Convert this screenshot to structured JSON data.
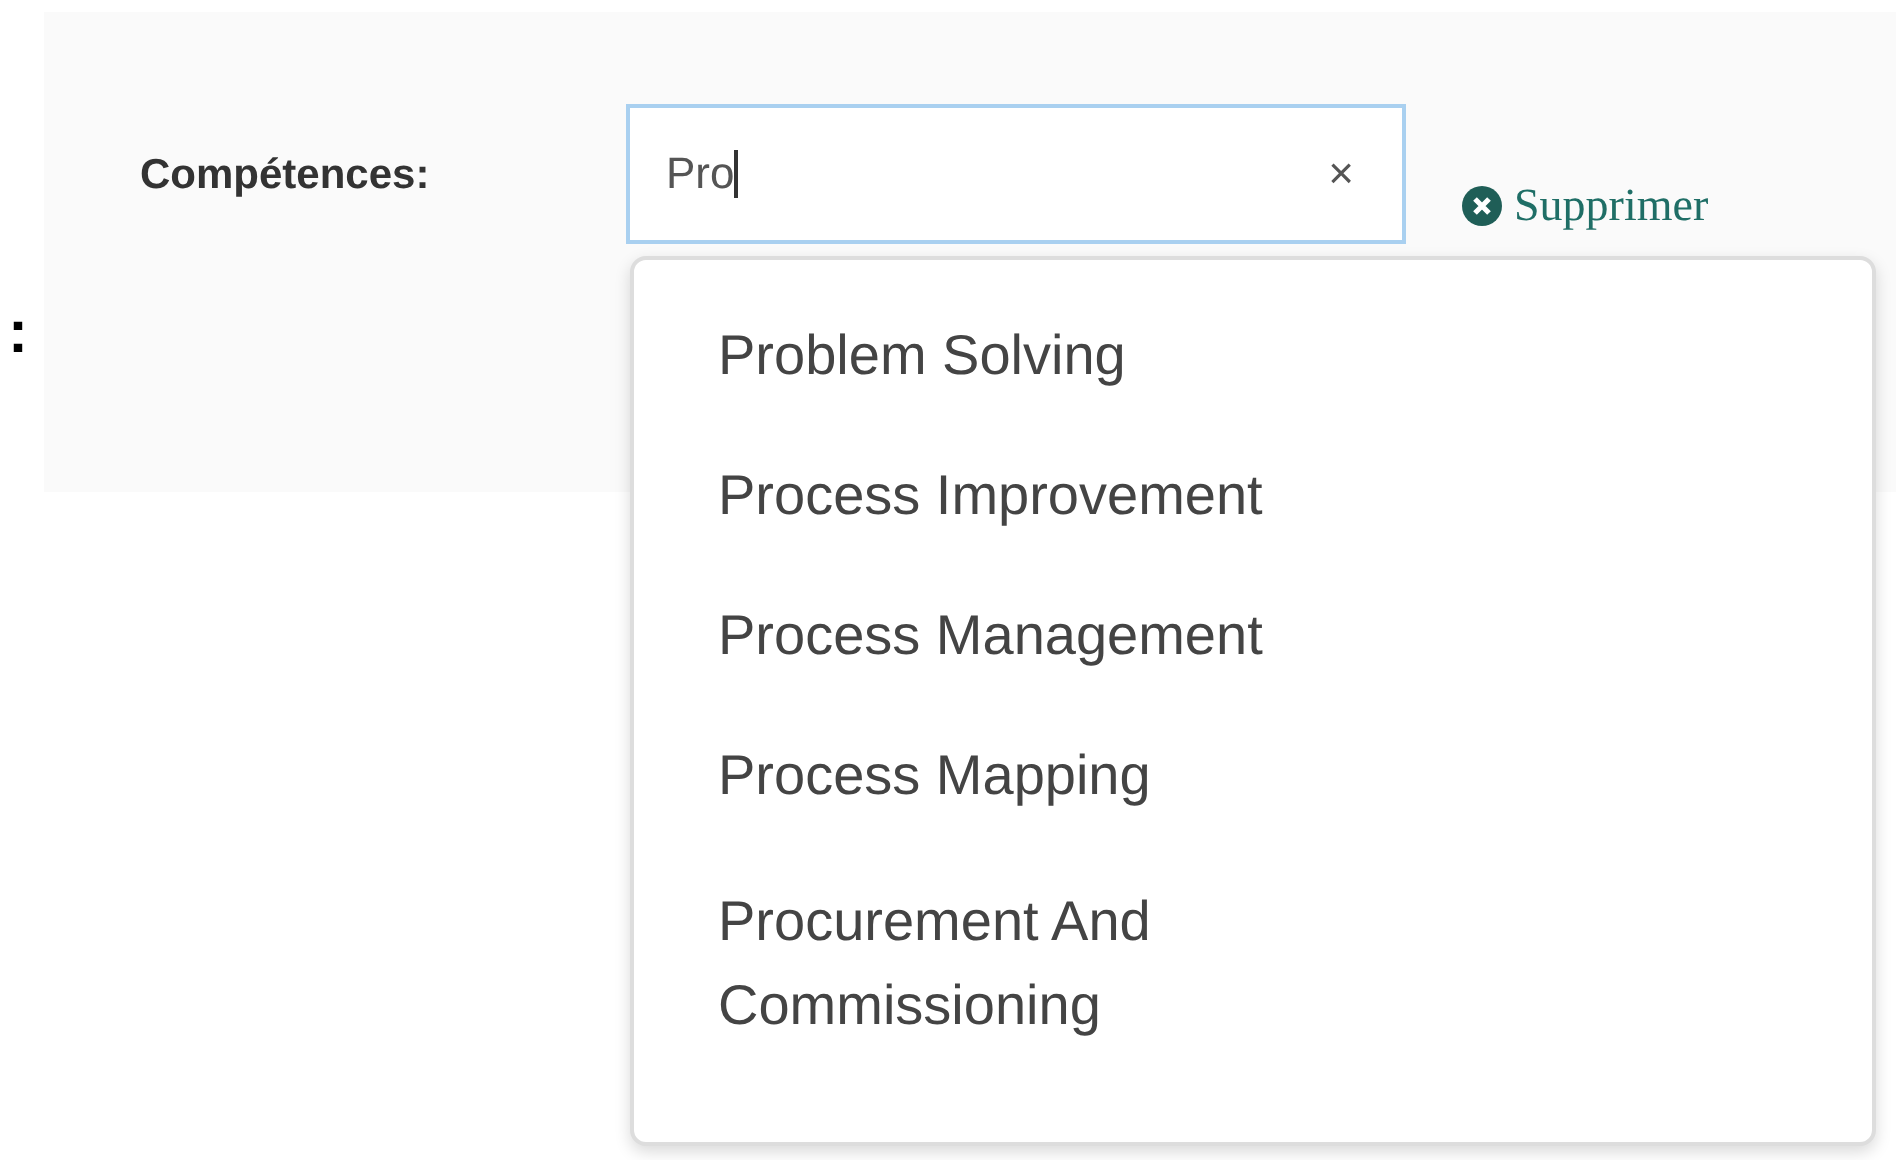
{
  "stray_text": ":",
  "field": {
    "label": "Compétences:",
    "value": "Pro",
    "clear": "×",
    "focused": true
  },
  "remove_link": {
    "label": "Supprimer"
  },
  "suggestions": [
    {
      "label": "Problem Solving"
    },
    {
      "label": "Process Improvement"
    },
    {
      "label": "Process Management"
    },
    {
      "label": "Process Mapping"
    },
    {
      "label": "Procurement And Commissioning"
    }
  ]
}
